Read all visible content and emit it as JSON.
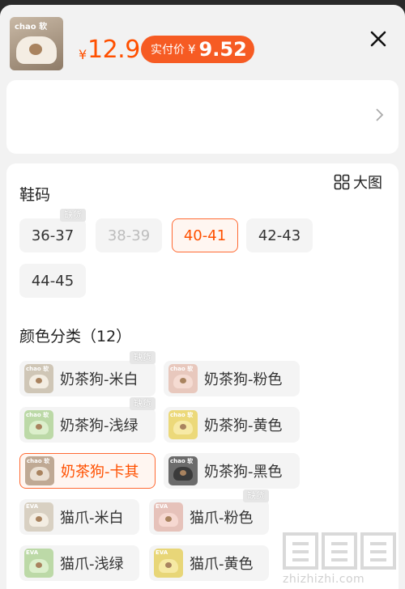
{
  "header": {
    "thumb_brand": "chao 软",
    "currency": "¥",
    "price": "12.9",
    "pay_label": "实付价",
    "pay_currency": "¥",
    "pay_price": "9.52"
  },
  "size": {
    "title": "鞋码",
    "options": [
      {
        "label": "36-37",
        "state": "normal"
      },
      {
        "label": "38-39",
        "state": "disabled",
        "tag": "缺货"
      },
      {
        "label": "40-41",
        "state": "selected"
      },
      {
        "label": "42-43",
        "state": "normal"
      },
      {
        "label": "44-45",
        "state": "normal"
      }
    ]
  },
  "color": {
    "title": "颜色分类（12）",
    "bigpic_label": "大图",
    "options": [
      {
        "label": "奶茶狗-米白",
        "tag": "缺货",
        "thumb_text": "chao 软",
        "bg": "#cfc6b6",
        "slipper": "#f3ede2"
      },
      {
        "label": "奶茶狗-粉色",
        "thumb_text": "chao 软",
        "bg": "#e8c8bd",
        "slipper": "#f5dbd2"
      },
      {
        "label": "奶茶狗-浅绿",
        "tag": "缺货",
        "thumb_text": "chao 软",
        "bg": "#bcd9a7",
        "slipper": "#dcefcc"
      },
      {
        "label": "奶茶狗-黄色",
        "thumb_text": "chao 软",
        "bg": "#ecd97a",
        "slipper": "#f7eaa6"
      },
      {
        "label": "奶茶狗-卡其",
        "state": "selected",
        "thumb_text": "chao 软",
        "bg": "#bfa994",
        "slipper": "#eadfd2"
      },
      {
        "label": "奶茶狗-黑色",
        "thumb_text": "chao 软",
        "bg": "#6b6b6b",
        "slipper": "#3b3b3b"
      },
      {
        "label": "猫爪-米白",
        "thumb_text": "EVA",
        "bg": "#d8d0c2",
        "slipper": "#f3ede2"
      },
      {
        "label": "猫爪-粉色",
        "tag": "缺货",
        "thumb_text": "EVA",
        "bg": "#e6c2ba",
        "slipper": "#f6d8d1"
      },
      {
        "label": "猫爪-浅绿",
        "thumb_text": "EVA",
        "bg": "#bcd9a7",
        "slipper": "#dcefcc"
      },
      {
        "label": "猫爪-黄色",
        "thumb_text": "EVA",
        "bg": "#e8d678",
        "slipper": "#f6e9a4"
      }
    ]
  },
  "watermark": {
    "text": "zhizhizhi.com"
  },
  "colors": {
    "accent": "#ff5000",
    "badge_bg": "#f65b23",
    "sheet_bg": "#f2f2f2"
  }
}
